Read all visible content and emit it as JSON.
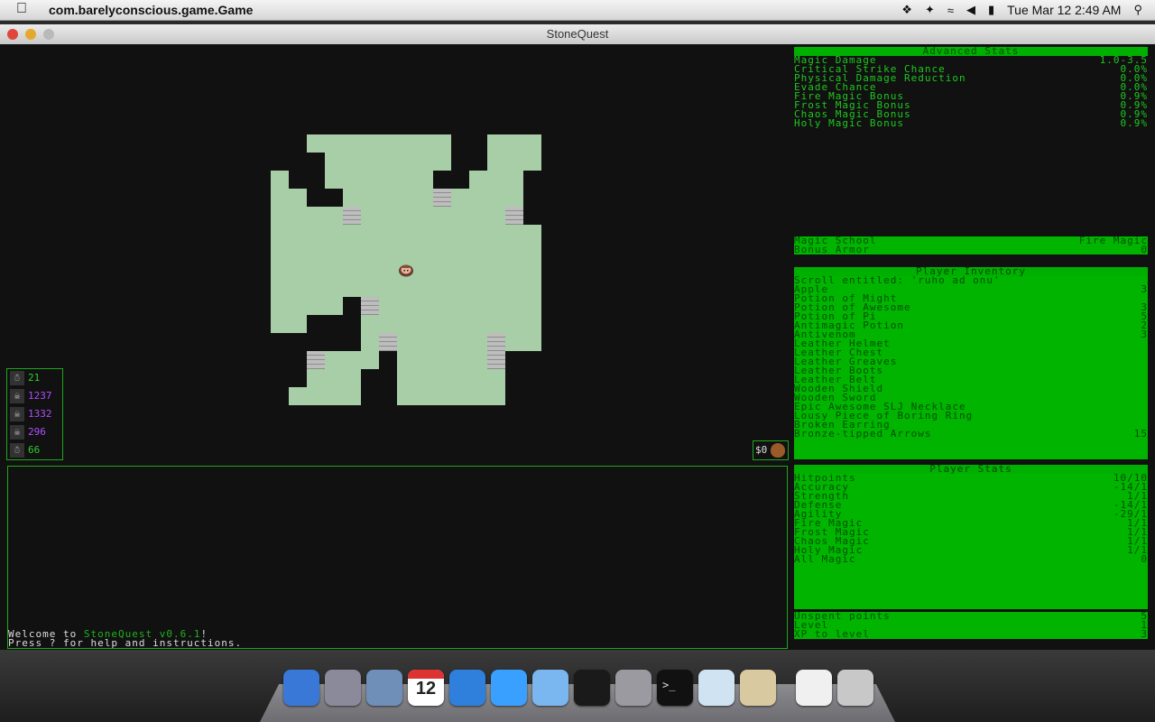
{
  "menubar": {
    "app_name": "com.barelyconscious.game.Game",
    "clock": "Tue Mar 12  2:49 AM"
  },
  "window": {
    "title": "StoneQuest"
  },
  "counters": [
    {
      "icon": "turtle-icon",
      "value": "21",
      "color": "#2ecc2e"
    },
    {
      "icon": "skull-icon",
      "value": "1237",
      "color": "#b04fff"
    },
    {
      "icon": "skull-icon",
      "value": "1332",
      "color": "#b04fff"
    },
    {
      "icon": "skull-icon",
      "value": "296",
      "color": "#b04fff"
    },
    {
      "icon": "turtle-icon",
      "value": "66",
      "color": "#2ecc2e"
    }
  ],
  "gold": {
    "value": "$0"
  },
  "log": {
    "line1_prefix": "Welcome to ",
    "line1_game": "StoneQuest v0.6.1",
    "line1_suffix": "!",
    "line2": "Press ? for help and instructions."
  },
  "advanced_stats": {
    "header": "Advanced Stats",
    "rows": [
      {
        "label": "Magic Damage",
        "value": "1.0-3.5"
      },
      {
        "label": "Critical Strike Chance",
        "value": "0.0%"
      },
      {
        "label": "Physical Damage Reduction",
        "value": "0.0%"
      },
      {
        "label": "Evade Chance",
        "value": "0.0%"
      },
      {
        "label": "Fire Magic Bonus",
        "value": "0.9%"
      },
      {
        "label": "Frost Magic Bonus",
        "value": "0.9%"
      },
      {
        "label": "Chaos Magic Bonus",
        "value": "0.9%"
      },
      {
        "label": "Holy Magic Bonus",
        "value": "0.9%"
      }
    ]
  },
  "magic": {
    "rows": [
      {
        "label": "Magic School",
        "value": "Fire Magic"
      },
      {
        "label": "Bonus Armor",
        "value": "0"
      }
    ]
  },
  "inventory": {
    "header": "Player Inventory",
    "rows": [
      {
        "label": "Scroll entitled: 'ruho ad onu'",
        "value": ""
      },
      {
        "label": "Apple",
        "value": "3"
      },
      {
        "label": "Potion of Might",
        "value": ""
      },
      {
        "label": "Potion of Awesome",
        "value": "3"
      },
      {
        "label": "Potion of Pi",
        "value": "5"
      },
      {
        "label": "Antimagic Potion",
        "value": "2"
      },
      {
        "label": "Antivenom",
        "value": "3"
      },
      {
        "label": "Leather Helmet",
        "value": ""
      },
      {
        "label": "Leather Chest",
        "value": ""
      },
      {
        "label": "Leather Greaves",
        "value": ""
      },
      {
        "label": "Leather Boots",
        "value": ""
      },
      {
        "label": "Leather Belt",
        "value": ""
      },
      {
        "label": "Wooden Shield",
        "value": ""
      },
      {
        "label": "Wooden Sword",
        "value": ""
      },
      {
        "label": "Epic Awesome SLJ Necklace",
        "value": ""
      },
      {
        "label": "Lousy Piece of Boring Ring",
        "value": ""
      },
      {
        "label": "Broken Earring",
        "value": ""
      },
      {
        "label": "Bronze-tipped Arrows",
        "value": "15"
      }
    ]
  },
  "player_stats": {
    "header": "Player Stats",
    "rows": [
      {
        "label": "Hitpoints",
        "value": "10/10"
      },
      {
        "label": "Accuracy",
        "value": "-14/1"
      },
      {
        "label": "Strength",
        "value": "1/1"
      },
      {
        "label": "Defense",
        "value": "-14/1"
      },
      {
        "label": "Agility",
        "value": "-29/1"
      },
      {
        "label": "Fire Magic",
        "value": "1/1"
      },
      {
        "label": "Frost Magic",
        "value": "1/1"
      },
      {
        "label": "Chaos Magic",
        "value": "1/1"
      },
      {
        "label": "Holy Magic",
        "value": "1/1"
      },
      {
        "label": "All Magic",
        "value": "0"
      }
    ],
    "footer": [
      {
        "label": "Unspent points",
        "value": "5"
      },
      {
        "label": "Level",
        "value": "1"
      },
      {
        "label": "XP to level",
        "value": "3"
      }
    ]
  },
  "dock": {
    "apps": [
      "finder-icon",
      "launchpad-icon",
      "mail-icon",
      "calendar-icon",
      "safari-icon",
      "itunes-icon",
      "facetime-icon",
      "activity-monitor-icon",
      "system-preferences-icon",
      "terminal-icon",
      "box-app-icon",
      "preview-icon",
      "document-stack-icon",
      "trash-icon"
    ],
    "calendar_day": "12"
  }
}
